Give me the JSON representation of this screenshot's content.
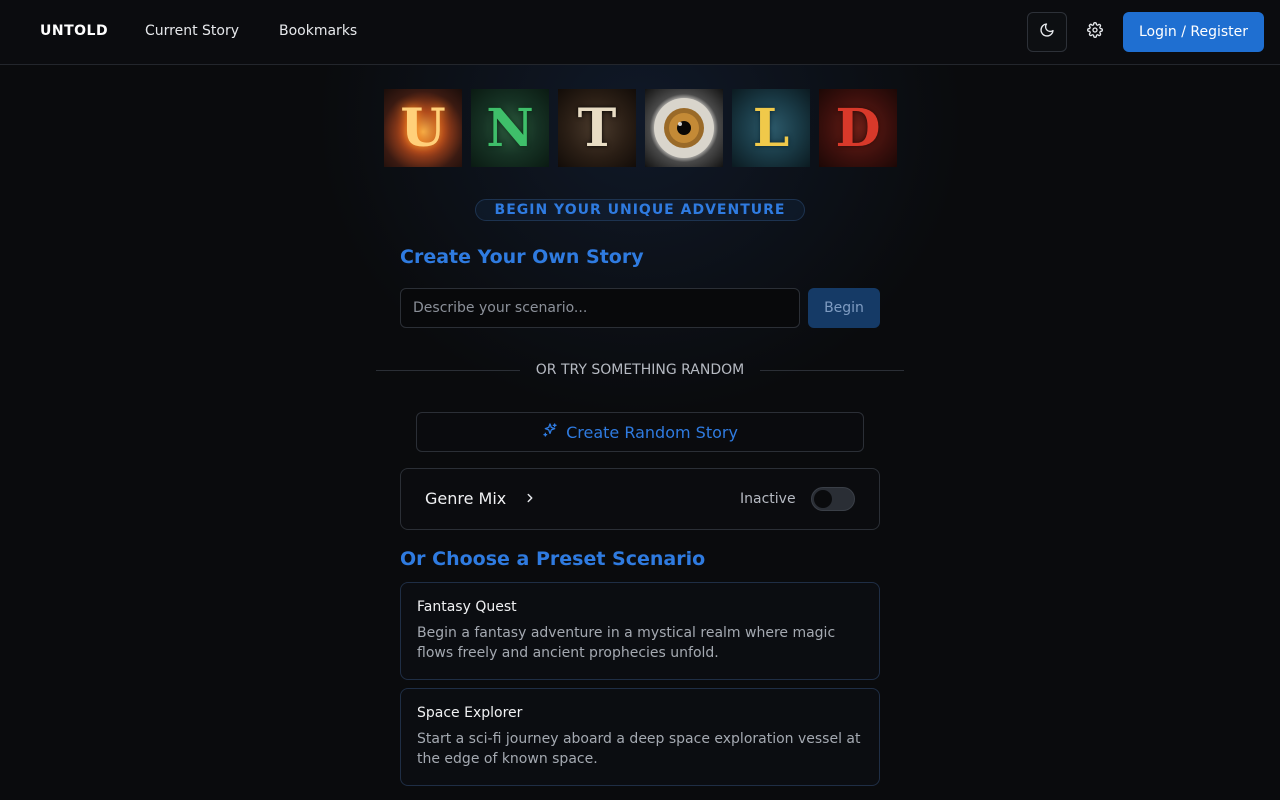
{
  "header": {
    "brand": "UNTOLD",
    "nav": {
      "current_story": "Current Story",
      "bookmarks": "Bookmarks"
    },
    "login_label": "Login / Register",
    "icons": {
      "theme": "moon-icon",
      "settings": "gear-icon"
    }
  },
  "logo": {
    "letters": [
      "U",
      "N",
      "T",
      "O",
      "L",
      "D"
    ]
  },
  "hero": {
    "tagline": "BEGIN YOUR UNIQUE ADVENTURE"
  },
  "create": {
    "title": "Create Your Own Story",
    "placeholder": "Describe your scenario...",
    "begin_label": "Begin"
  },
  "divider": {
    "text": "OR TRY SOMETHING RANDOM"
  },
  "random": {
    "label": "Create Random Story",
    "icon": "sparkles-icon"
  },
  "genre_mix": {
    "label": "Genre Mix",
    "status": "Inactive",
    "enabled": false
  },
  "presets": {
    "title": "Or Choose a Preset Scenario",
    "items": [
      {
        "name": "Fantasy Quest",
        "description": "Begin a fantasy adventure in a mystical realm where magic flows freely and ancient prophecies unfold."
      },
      {
        "name": "Space Explorer",
        "description": "Start a sci-fi journey aboard a deep space exploration vessel at the edge of known space."
      }
    ]
  },
  "colors": {
    "accent": "#2f7be0",
    "login_button": "#1f6fd1",
    "background": "#0a0b0d"
  }
}
